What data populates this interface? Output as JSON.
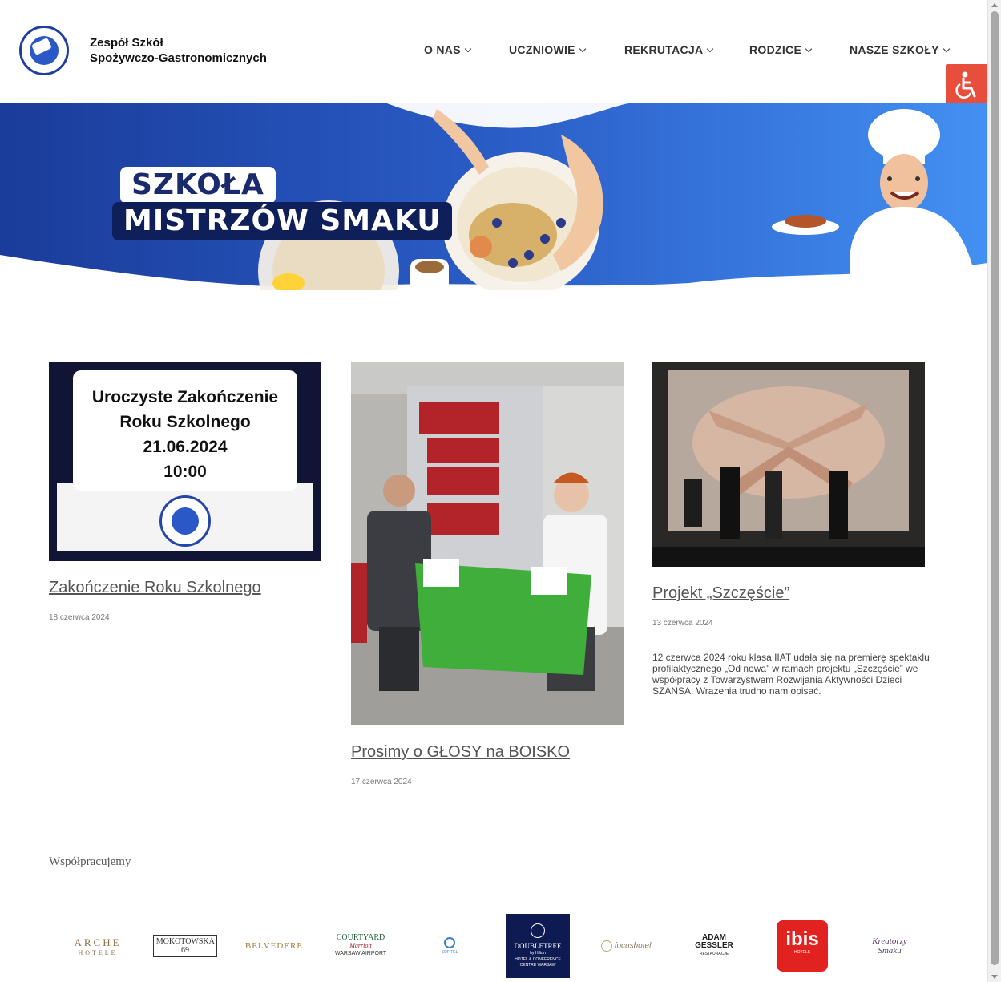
{
  "header": {
    "brand_line1": "Zespół Szkół",
    "brand_line2": "Spożywczo-Gastronomicznych",
    "nav": [
      "O NAS",
      "UCZNIOWIE",
      "REKRUTACJA",
      "RODZICE",
      "NASZE SZKOŁY"
    ]
  },
  "hero": {
    "title_line1": "SZKOŁA",
    "title_line2": "MISTRZÓW SMAKU"
  },
  "posts": [
    {
      "image_text": [
        "Uroczyste Zakończenie",
        "Roku Szkolnego",
        "21.06.2024",
        "10:00"
      ],
      "title": "Zakończenie Roku Szkolnego",
      "date": "18 czerwca 2024"
    },
    {
      "title": "Prosimy o GŁOSY na BOISKO",
      "date": "17 czerwca 2024"
    },
    {
      "title": "Projekt „Szczęście”",
      "date": "13 czerwca 2024",
      "excerpt": "12 czerwca 2024 roku klasa IIAT udała się na premierę spektaklu profilaktycznego „Od nowa” w ramach projektu „Szczęście” we współpracy z Towarzystwem Rozwijania Aktywności Dzieci SZANSA. Wrażenia trudno nam opisać."
    }
  ],
  "partners": {
    "title": "Współpracujemy",
    "logos": [
      {
        "line1": "ARCHE",
        "line2": "HOTELE"
      },
      {
        "line1": "MOKOTOWSKA 69",
        "line2": ""
      },
      {
        "line1": "BELVEDERE",
        "line2": ""
      },
      {
        "line1": "COURTYARD",
        "line2": "Marriott",
        "line3": "WARSAW AIRPORT"
      },
      {
        "line1": "SOFITEL",
        "line2": ""
      },
      {
        "line1": "DOUBLETREE",
        "line2": "by Hilton",
        "line3": "HOTEL & CONFERENCE CENTRE WARSAW"
      },
      {
        "line1": "focushotel",
        "line2": ""
      },
      {
        "line1": "ADAM GESSLER",
        "line2": "RESTAURACJE"
      },
      {
        "line1": "ibis",
        "line2": "HOTELS"
      },
      {
        "line1": "Kreatorzy",
        "line2": "Smaku"
      }
    ]
  },
  "colors": {
    "hero_blue_dark": "#1a3c9a",
    "hero_blue_light": "#3b8ff0",
    "accessibility": "#e84e3c",
    "title_navy": "#0f1f5a"
  },
  "icons": [
    "accessibility-icon",
    "chevron-down-icon"
  ]
}
